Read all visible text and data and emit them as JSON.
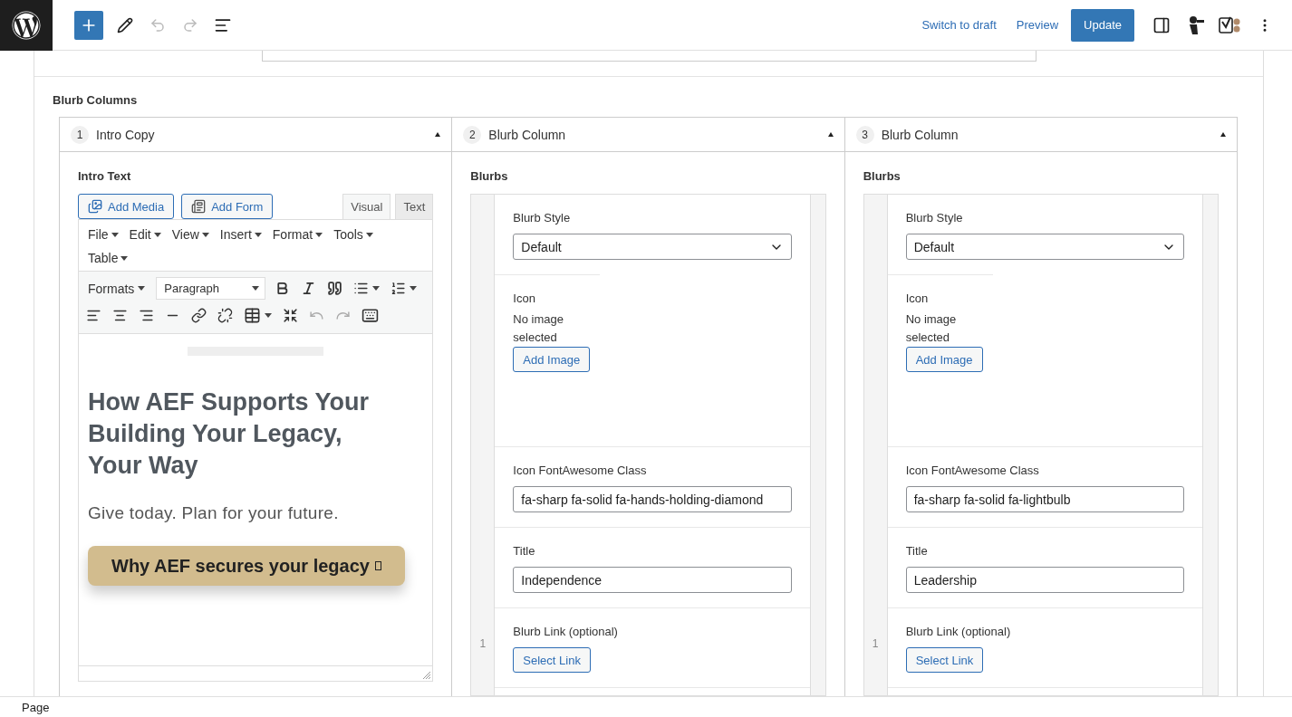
{
  "topbar": {
    "links": [
      "Switch to draft",
      "Preview"
    ],
    "primary": "Update"
  },
  "section_label": "Blurb Columns",
  "columns": [
    {
      "kind": "intro",
      "number": "1",
      "title": "Intro Copy",
      "field_label": "Intro Text",
      "editor": {
        "media_buttons": [
          {
            "kind": "media",
            "label": "Add Media"
          },
          {
            "kind": "form",
            "label": "Add Form"
          }
        ],
        "tabs": [
          {
            "label": "Visual",
            "selected": true
          },
          {
            "label": "Text",
            "selected": false
          }
        ],
        "menus": [
          "File",
          "Edit",
          "View",
          "Insert",
          "Format",
          "Tools",
          "Table"
        ],
        "formats": "Formats",
        "block_format": "Paragraph",
        "heading": "How AEF Supports Your Building Your Legacy, Your Way",
        "subheading": "Give today. Plan for your future.",
        "cta": "Why AEF secures your legacy"
      }
    },
    {
      "kind": "blurbs",
      "number": "2",
      "title": "Blurb Column",
      "field_label": "Blurbs",
      "row_number": "1",
      "style_label": "Blurb Style",
      "style_value": "Default",
      "icon_label": "Icon",
      "icon_empty": "No image selected",
      "icon_button": "Add Image",
      "class_label": "Icon FontAwesome Class",
      "class_value": "fa-sharp fa-solid fa-hands-holding-diamond",
      "title_label": "Title",
      "title_value": "Independence",
      "link_label": "Blurb Link (optional)",
      "link_button": "Select Link"
    },
    {
      "kind": "blurbs",
      "number": "3",
      "title": "Blurb Column",
      "field_label": "Blurbs",
      "row_number": "1",
      "style_label": "Blurb Style",
      "style_value": "Default",
      "icon_label": "Icon",
      "icon_empty": "No image selected",
      "icon_button": "Add Image",
      "class_label": "Icon FontAwesome Class",
      "class_value": "fa-sharp fa-solid fa-lightbulb",
      "title_label": "Title",
      "title_value": "Leadership",
      "link_label": "Blurb Link (optional)",
      "link_button": "Select Link"
    }
  ],
  "status_bar": "Page"
}
